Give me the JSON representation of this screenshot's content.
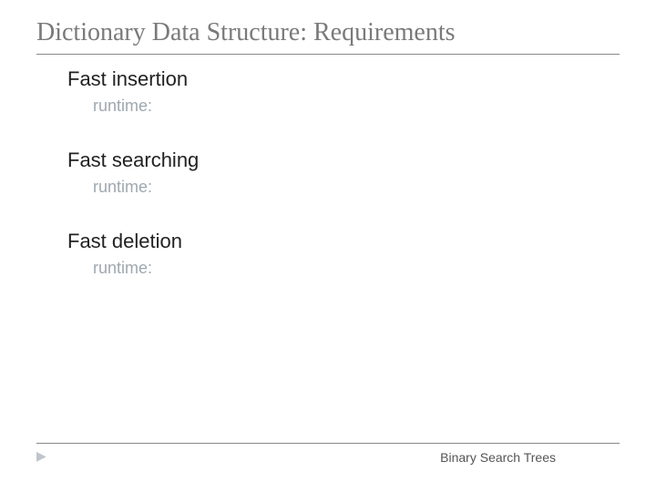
{
  "title": "Dictionary Data Structure: Requirements",
  "items": [
    {
      "label": "Fast insertion",
      "sub": "runtime:"
    },
    {
      "label": "Fast searching",
      "sub": "runtime:"
    },
    {
      "label": "Fast deletion",
      "sub": "runtime:"
    }
  ],
  "footer": {
    "text": "Binary Search Trees"
  }
}
